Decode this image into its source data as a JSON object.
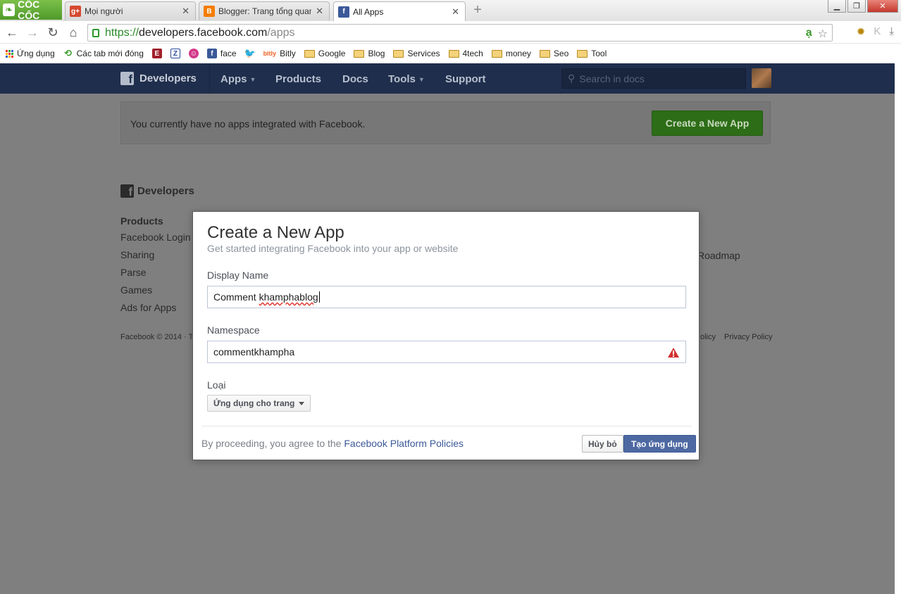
{
  "browser": {
    "logo_text": "CỐC CỐC",
    "tabs": [
      {
        "title": "Mọi người",
        "favicon": "google-plus-icon",
        "color": "#d6492f"
      },
      {
        "title": "Blogger: Trang tổng quan",
        "favicon": "blogger-icon",
        "color": "#f57d00"
      },
      {
        "title": "All Apps",
        "favicon": "facebook-icon",
        "color": "#3b5998"
      }
    ],
    "url": {
      "scheme": "https://",
      "host": "developers.facebook.com",
      "path": "/apps"
    },
    "bookmarks": [
      {
        "label": "Ứng dụng",
        "icon": "apps-grid-icon"
      },
      {
        "label": "Các tab mới đóng",
        "icon": "history-icon"
      },
      {
        "label": "",
        "icon": "e-icon"
      },
      {
        "label": "",
        "icon": "z-icon"
      },
      {
        "label": "",
        "icon": "smile-icon"
      },
      {
        "label": "face",
        "icon": "facebook-icon"
      },
      {
        "label": "",
        "icon": "twitter-icon"
      },
      {
        "label": "Bitly",
        "icon": "bitly-icon"
      },
      {
        "label": "Google",
        "icon": "folder-icon"
      },
      {
        "label": "Blog",
        "icon": "folder-icon"
      },
      {
        "label": "Services",
        "icon": "folder-icon"
      },
      {
        "label": "4tech",
        "icon": "folder-icon"
      },
      {
        "label": "money",
        "icon": "folder-icon"
      },
      {
        "label": "Seo",
        "icon": "folder-icon"
      },
      {
        "label": "Tool",
        "icon": "folder-icon"
      }
    ]
  },
  "fb_header": {
    "brand": "Developers",
    "nav": [
      {
        "label": "Apps",
        "has_caret": true
      },
      {
        "label": "Products",
        "has_caret": false
      },
      {
        "label": "Docs",
        "has_caret": false
      },
      {
        "label": "Tools",
        "has_caret": true
      },
      {
        "label": "Support",
        "has_caret": false
      }
    ],
    "search_placeholder": "Search in docs"
  },
  "notice": {
    "text": "You currently have no apps integrated with Facebook.",
    "button": "Create a New App"
  },
  "footer": {
    "brand": "Developers",
    "heading": "Products",
    "links": [
      "Facebook Login",
      "Sharing",
      "Parse",
      "Games",
      "Ads for Apps"
    ],
    "copyright": "Facebook © 2014 · T",
    "right_link": "Roadmap",
    "right_small_1": "olicy",
    "right_small_2": "Privacy Policy"
  },
  "dialog": {
    "title": "Create a New App",
    "subtitle": "Get started integrating Facebook into your app or website",
    "display_name_label": "Display Name",
    "display_name_value_a": "Comment ",
    "display_name_value_b": "khamphablog",
    "namespace_label": "Namespace",
    "namespace_value": "commentkhampha",
    "type_label": "Loại",
    "type_value": "Ứng dụng cho trang",
    "policy_text": "By proceeding, you agree to the ",
    "policy_link": "Facebook Platform Policies",
    "cancel": "Hủy bỏ",
    "submit": "Tạo ứng dụng"
  },
  "colors": {
    "fb_header": "#1f2e4c",
    "create_button": "#2d6d17",
    "submit_button": "#4e69a2",
    "warning": "#d32f2f"
  }
}
